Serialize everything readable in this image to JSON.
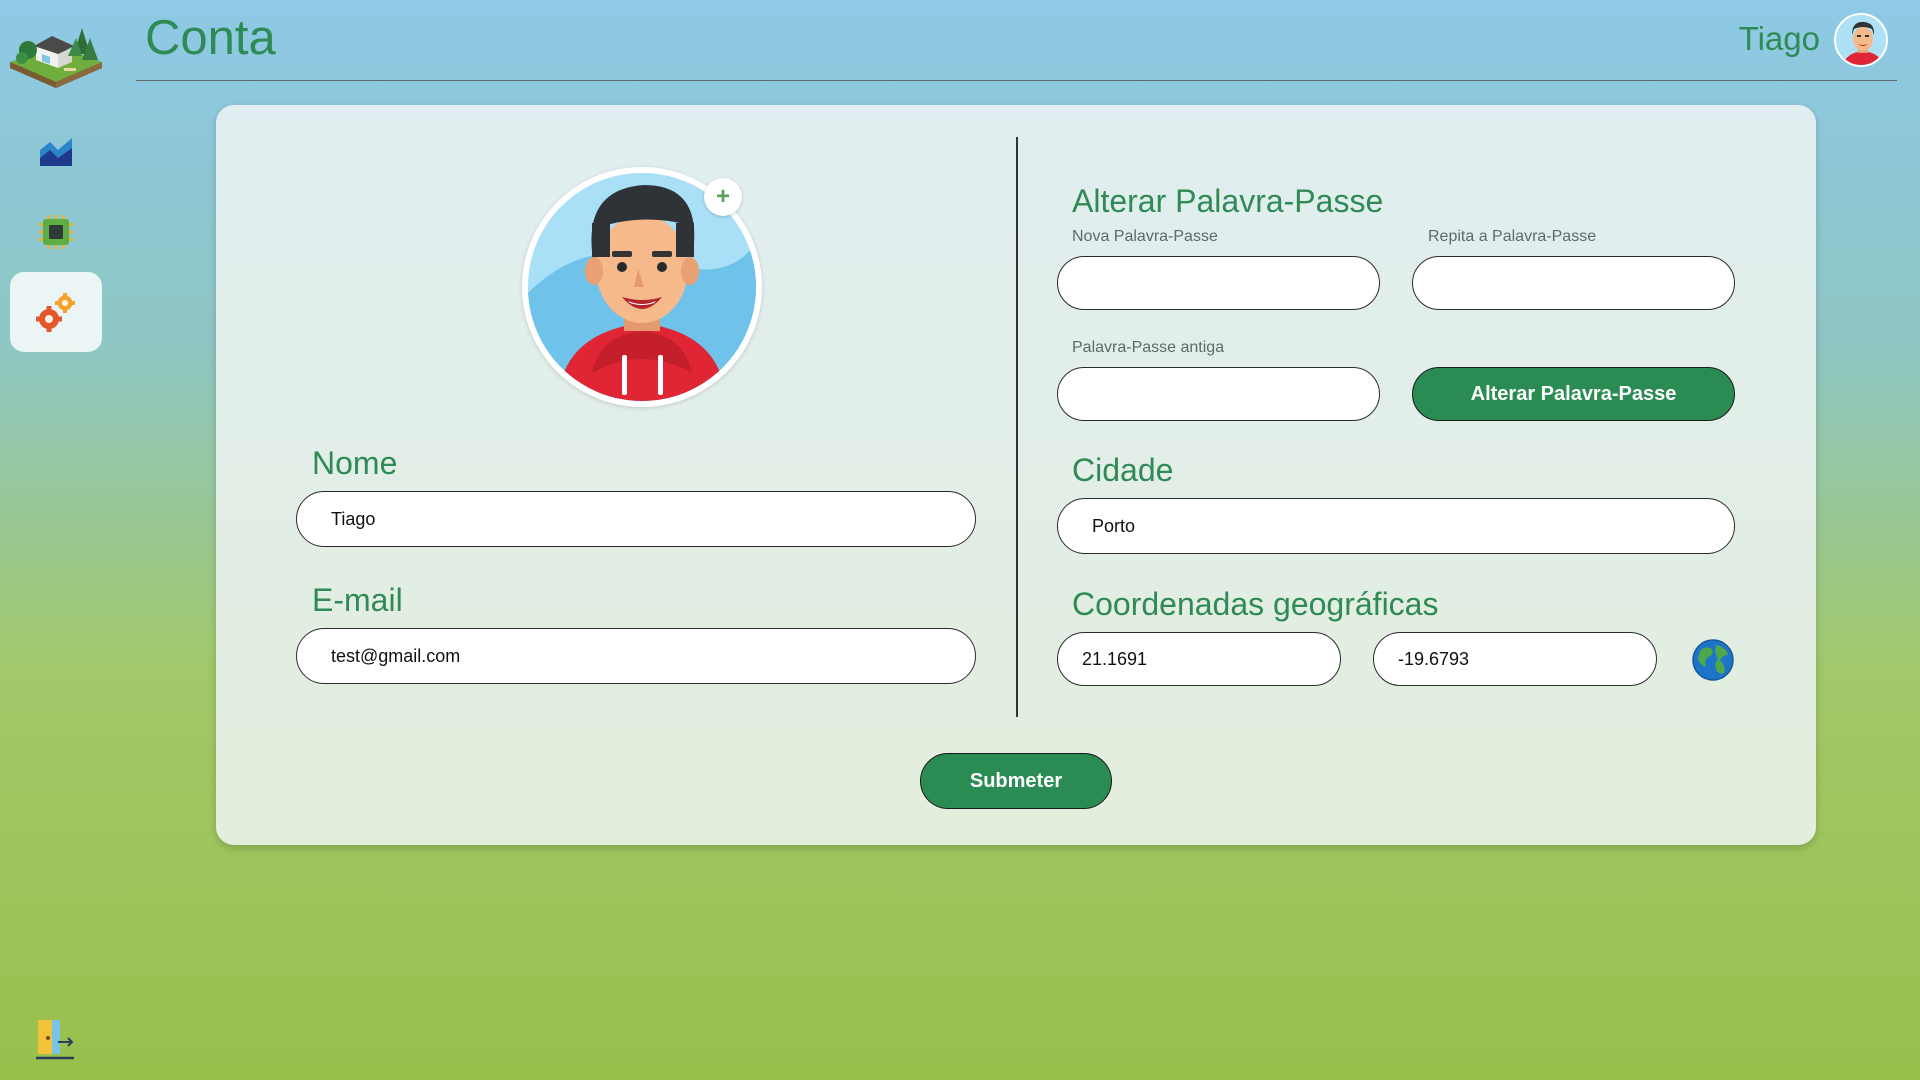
{
  "header": {
    "title": "Conta",
    "user_name": "Tiago"
  },
  "sidebar": {
    "items": [
      {
        "icon": "chart-icon",
        "active": false
      },
      {
        "icon": "chip-icon",
        "active": false
      },
      {
        "icon": "gears-icon",
        "active": true
      }
    ],
    "logout_icon": "logout-door-icon"
  },
  "profile": {
    "name_label": "Nome",
    "name_value": "Tiago",
    "email_label": "E-mail",
    "email_value": "test@gmail.com",
    "avatar_add": "+"
  },
  "password": {
    "section_title": "Alterar Palavra-Passe",
    "new_label": "Nova Palavra-Passe",
    "repeat_label": "Repita a Palavra-Passe",
    "old_label": "Palavra-Passe antiga",
    "button_label": "Alterar Palavra-Passe"
  },
  "location": {
    "city_label": "Cidade",
    "city_value": "Porto",
    "coords_label": "Coordenadas geográficas",
    "lat_value": "21.1691",
    "lon_value": "-19.6793"
  },
  "submit_label": "Submeter",
  "colors": {
    "accent": "#2f8a55",
    "button": "#2a8c53"
  }
}
